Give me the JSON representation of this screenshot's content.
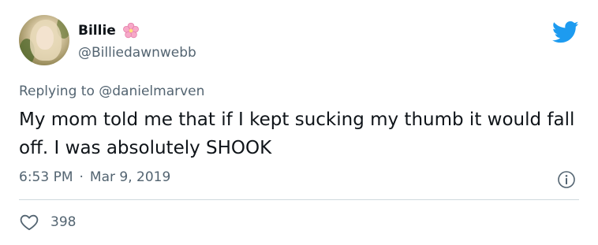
{
  "user": {
    "display_name": "Billie",
    "handle": "@Billiedawnwebb",
    "avatar": "profile-photo",
    "name_emoji": "cherry-blossom-icon"
  },
  "reply": {
    "prefix": "Replying to",
    "mention": "@danielmarven"
  },
  "tweet": {
    "text": "My mom told me that if I kept sucking my thumb it would fall off. I was absolutely SHOOK"
  },
  "meta": {
    "time": "6:53 PM",
    "separator": "·",
    "date": "Mar 9, 2019"
  },
  "engagement": {
    "likes": "398"
  },
  "colors": {
    "twitter_blue": "#1d9bf0",
    "secondary_text": "#536471",
    "primary_text": "#0f1419",
    "divider": "#cfd9de",
    "flower_pink": "#f7a8c8"
  }
}
